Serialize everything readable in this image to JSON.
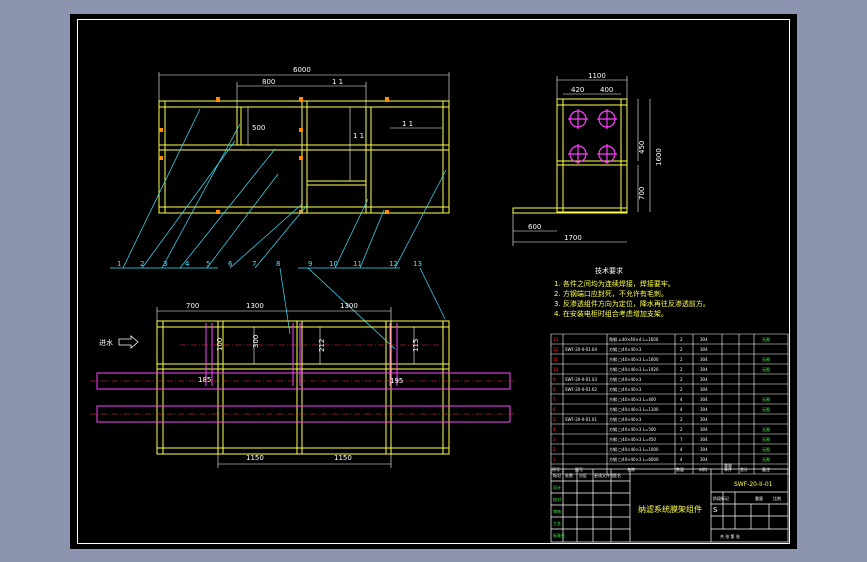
{
  "drawing": {
    "front_view": {
      "dims_top": [
        "6000",
        "800",
        "1 1"
      ],
      "dims_side": [
        "500",
        "1 1",
        "1 1"
      ]
    },
    "side_view": {
      "dims": [
        "1100",
        "420",
        "400",
        "450",
        "1600",
        "700",
        "600",
        "1700"
      ]
    },
    "plan_view": {
      "dims_top": [
        "700",
        "1300",
        "1300"
      ],
      "dims_inner": [
        "300",
        "100",
        "212",
        "115",
        "195",
        "185"
      ],
      "dims_bottom": [
        "1150",
        "1150"
      ],
      "flow_label": "进水"
    },
    "callouts": [
      "1",
      "2",
      "3",
      "4",
      "5",
      "6",
      "7",
      "8",
      "9",
      "10",
      "11",
      "12",
      "13"
    ],
    "tech_notes": {
      "title": "技术要求",
      "items": [
        "1. 各件之间均为连续焊接，焊接要牢。",
        "2. 方钢端口应封死，不允许有毛刺。",
        "3. 反渗透组件方向为定位，降水再往反渗透前方。",
        "4. 在安装电柜时组合考虑增加支架。"
      ]
    },
    "parts_list": {
      "header": [
        "序号",
        "图号",
        "名称",
        "数量",
        "材料",
        "单件",
        "总计",
        "备注"
      ],
      "rows": [
        {
          "no": "13",
          "code": "",
          "name": "角钢 ∠40×40×4 L=1600",
          "qty": "2",
          "mat": "304",
          "note": "无图"
        },
        {
          "no": "12",
          "code": "SWF-20-II-01.04",
          "name": "方钢 □40×40×3",
          "qty": "2",
          "mat": "304",
          "note": ""
        },
        {
          "no": "11",
          "code": "",
          "name": "方钢 □40×40×3 L=1600",
          "qty": "2",
          "mat": "304",
          "note": "无图"
        },
        {
          "no": "10",
          "code": "",
          "name": "方钢 □40×40×3 L=1920",
          "qty": "2",
          "mat": "304",
          "note": "无图"
        },
        {
          "no": "9",
          "code": "SWF-20-II-01.03",
          "name": "方钢 □40×40×3",
          "qty": "2",
          "mat": "304",
          "note": ""
        },
        {
          "no": "8",
          "code": "SWF-20-II-01.02",
          "name": "方钢 □40×40×3",
          "qty": "2",
          "mat": "304",
          "note": ""
        },
        {
          "no": "7",
          "code": "",
          "name": "方钢 □40×40×3 L=400",
          "qty": "4",
          "mat": "304",
          "note": "无图"
        },
        {
          "no": "6",
          "code": "",
          "name": "方钢 □40×40×3 L=1100",
          "qty": "4",
          "mat": "304",
          "note": "无图"
        },
        {
          "no": "5",
          "code": "SWF-20-II-01.01",
          "name": "方钢 □40×40×3",
          "qty": "2",
          "mat": "304",
          "note": ""
        },
        {
          "no": "4",
          "code": "",
          "name": "方钢 □40×40×3 L=500",
          "qty": "2",
          "mat": "304",
          "note": "无图"
        },
        {
          "no": "3",
          "code": "",
          "name": "方钢 □40×40×3 L=450",
          "qty": "7",
          "mat": "304",
          "note": "无图"
        },
        {
          "no": "2",
          "code": "",
          "name": "方钢 □40×40×3 L=1000",
          "qty": "4",
          "mat": "304",
          "note": "无图"
        },
        {
          "no": "1",
          "code": "",
          "name": "方钢 □40×40×3 L=6000",
          "qty": "4",
          "mat": "304",
          "note": "无图"
        }
      ],
      "mass_label": "重量"
    },
    "title_block": {
      "drawing_no": "SWF-20-II-01",
      "title": "纳滤系统膜架组件",
      "scale_label": "比例",
      "weight_label": "重量",
      "sheet_label": "共 张 第 张",
      "stage_label": "阶段标记",
      "stage_value": "S",
      "rev_labels": [
        "标记",
        "处数",
        "分区",
        "更改文件号",
        "签名",
        "年月日"
      ],
      "role_labels": [
        "设计",
        "校对",
        "审核",
        "工艺",
        "标准化",
        "批准"
      ]
    }
  },
  "colors": {
    "background": "#8d94b0",
    "sheet": "#000000",
    "frame": "#ffffff",
    "steel": "#ffff4a",
    "dimension": "#ffffff",
    "leader": "#3ce6ff",
    "pipe": "#ff40ff",
    "pipe_center": "#ff3030",
    "table_green": "#40ff40"
  }
}
